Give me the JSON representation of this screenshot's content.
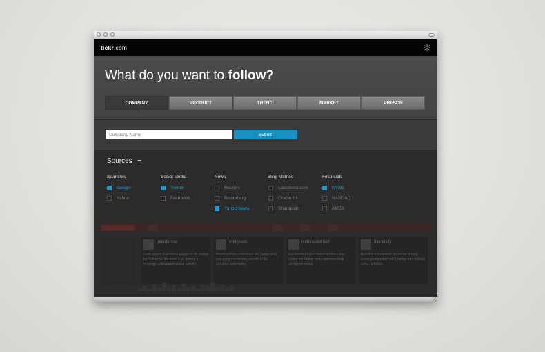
{
  "app": {
    "logo_bold": "tickr",
    "logo_rest": ".com"
  },
  "hero": {
    "headline_prefix": "What do you want to ",
    "headline_bold": "follow?",
    "tabs": [
      {
        "label": "COMPANY",
        "active": true
      },
      {
        "label": "PRODUCT",
        "active": false
      },
      {
        "label": "TREND",
        "active": false
      },
      {
        "label": "MARKET",
        "active": false
      },
      {
        "label": "PRESON",
        "active": false
      }
    ]
  },
  "form": {
    "placeholder": "Company Name",
    "submit_label": "Submit"
  },
  "sources": {
    "title": "Sources",
    "collapse_symbol": "−",
    "columns": [
      {
        "heading": "Searches",
        "items": [
          {
            "label": "Google",
            "checked": true
          },
          {
            "label": "Yahoo",
            "checked": false
          }
        ]
      },
      {
        "heading": "Social Media",
        "items": [
          {
            "label": "Twitter",
            "checked": true
          },
          {
            "label": "Facebook",
            "checked": false
          }
        ]
      },
      {
        "heading": "News",
        "items": [
          {
            "label": "Reuters",
            "checked": false
          },
          {
            "label": "Bloomberg",
            "checked": false
          },
          {
            "label": "Yahoo News",
            "checked": true
          }
        ]
      },
      {
        "heading": "Blog Metrics",
        "items": [
          {
            "label": "salesforce.com",
            "checked": false
          },
          {
            "label": "Oracle BI",
            "checked": false
          },
          {
            "label": "Sharepoint",
            "checked": false
          }
        ]
      },
      {
        "heading": "Financials",
        "items": [
          {
            "label": "NYSE",
            "checked": true
          },
          {
            "label": "NASDAQ",
            "checked": false
          },
          {
            "label": "AMEX",
            "checked": false
          }
        ]
      }
    ]
  },
  "background_feed": {
    "panels": [
      {
        "name": "peterfarrow",
        "text": "Daily report: Facebook Pages to be visited by Twitter as the main line, testing a redesign and launch social activity."
      },
      {
        "name": "robbyswiz",
        "text": "Brand activity scheduled via Twitter and engaging customers; results to be updated soon today."
      },
      {
        "name": "techinsidermail",
        "text": "Facebook Pages: brand updates are rolling out today; early numbers look strong on social."
      },
      {
        "name": "dashdaily",
        "text": "Brand is a superstar on social, strong earnings reported on Tuesday and holiday sales to follow."
      }
    ]
  },
  "colors": {
    "accent": "#1a9fd4",
    "submit": "#1a8fc1",
    "appbar": "#050505"
  },
  "icons": {
    "settings": "gear-icon"
  }
}
